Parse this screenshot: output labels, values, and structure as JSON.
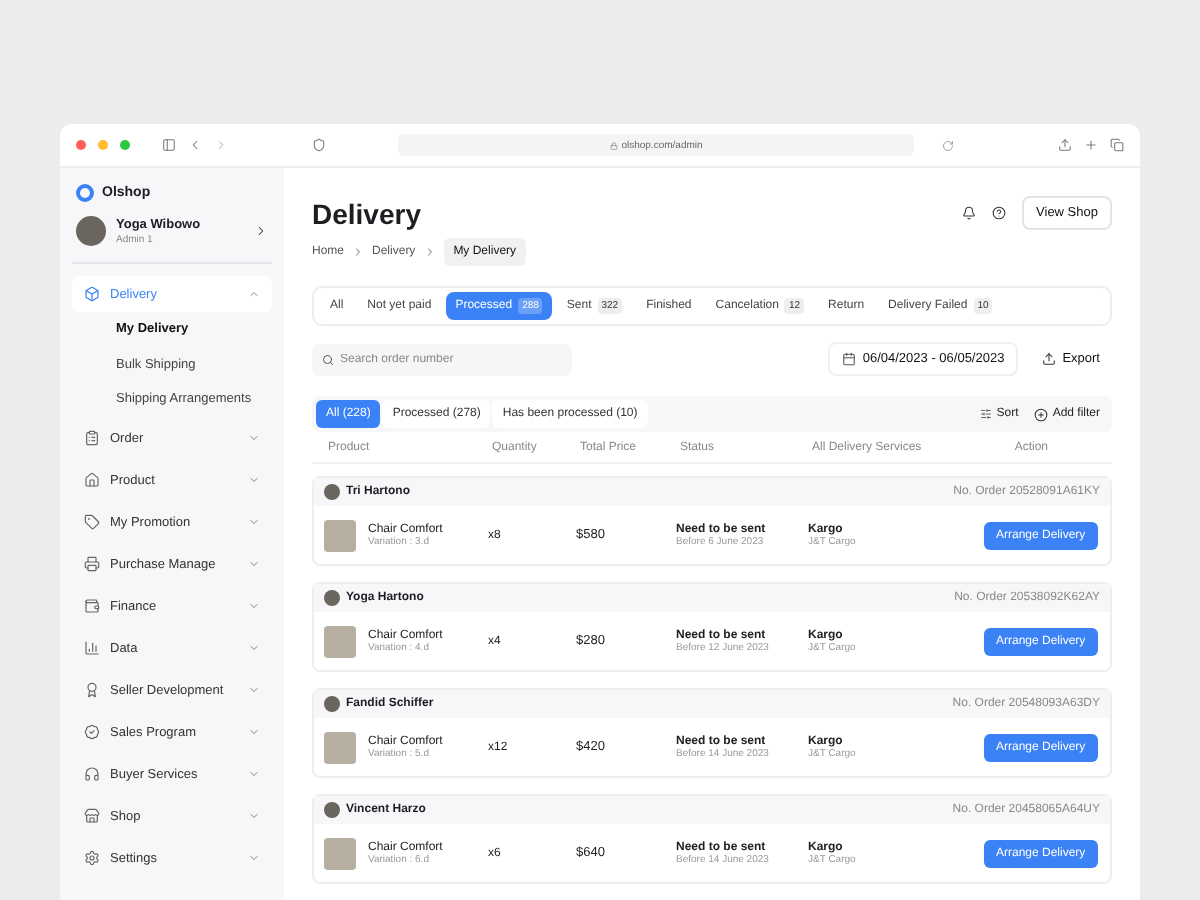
{
  "browser": {
    "url": "olshop.com/admin"
  },
  "sidebar": {
    "brand": "Olshop",
    "user": {
      "name": "Yoga Wibowo",
      "role": "Admin 1"
    },
    "items": [
      {
        "label": "Delivery",
        "expanded": true,
        "selected": true,
        "children": [
          {
            "label": "My Delivery",
            "selected": true
          },
          {
            "label": "Bulk Shipping",
            "selected": false
          },
          {
            "label": "Shipping Arrangements",
            "selected": false
          }
        ]
      },
      {
        "label": "Order",
        "expanded": false,
        "selected": false
      },
      {
        "label": "Product",
        "expanded": false,
        "selected": false
      },
      {
        "label": "My Promotion",
        "expanded": false,
        "selected": false
      },
      {
        "label": "Purchase Manage",
        "expanded": false,
        "selected": false
      },
      {
        "label": "Finance",
        "expanded": false,
        "selected": false
      },
      {
        "label": "Data",
        "expanded": false,
        "selected": false
      },
      {
        "label": "Seller Development",
        "expanded": false,
        "selected": false
      },
      {
        "label": "Sales Program",
        "expanded": false,
        "selected": false
      },
      {
        "label": "Buyer Services",
        "expanded": false,
        "selected": false
      },
      {
        "label": "Shop",
        "expanded": false,
        "selected": false
      },
      {
        "label": "Settings",
        "expanded": false,
        "selected": false
      }
    ]
  },
  "header": {
    "title": "Delivery",
    "view_shop": "View Shop"
  },
  "breadcrumb": [
    {
      "label": "Home",
      "selected": false
    },
    {
      "label": "Delivery",
      "selected": false
    },
    {
      "label": "My Delivery",
      "selected": true
    }
  ],
  "tabs": [
    {
      "label": "All",
      "selected": false
    },
    {
      "label": "Not yet paid",
      "selected": false
    },
    {
      "label": "Processed",
      "count": "288",
      "selected": true
    },
    {
      "label": "Sent",
      "count": "322",
      "selected": false
    },
    {
      "label": "Finished",
      "selected": false
    },
    {
      "label": "Cancelation",
      "count": "12",
      "selected": false
    },
    {
      "label": "Return",
      "selected": false
    },
    {
      "label": "Delivery Failed",
      "count": "10",
      "selected": false
    }
  ],
  "search": {
    "placeholder": "Search order number"
  },
  "date_range": "06/04/2023 - 06/05/2023",
  "export": "Export",
  "filters": [
    {
      "label": "All (228)",
      "selected": true
    },
    {
      "label": "Processed (278)",
      "selected": false
    },
    {
      "label": "Has been processed (10)",
      "selected": false
    }
  ],
  "sort": "Sort",
  "add_filter": "Add filter",
  "table": {
    "columns": [
      "Product",
      "Quantity",
      "Total Price",
      "Status",
      "All Delivery Services",
      "Action"
    ],
    "orders": [
      {
        "customer": "Tri Hartono",
        "order_no": "No. Order 20528091A61KY",
        "product": "Chair Comfort",
        "variation": "Variation : 3.d",
        "quantity": "x8",
        "price": "$580",
        "status": "Need to be sent",
        "deadline": "Before 6 June 2023",
        "service": "Kargo",
        "carrier": "J&T Cargo",
        "action": "Arrange Delivery"
      },
      {
        "customer": "Yoga Hartono",
        "order_no": "No. Order 20538092K62AY",
        "product": "Chair Comfort",
        "variation": "Variation : 4.d",
        "quantity": "x4",
        "price": "$280",
        "status": "Need to be sent",
        "deadline": "Before 12 June 2023",
        "service": "Kargo",
        "carrier": "J&T Cargo",
        "action": "Arrange Delivery"
      },
      {
        "customer": "Fandid Schiffer",
        "order_no": "No. Order 20548093A63DY",
        "product": "Chair Comfort",
        "variation": "Variation : 5.d",
        "quantity": "x12",
        "price": "$420",
        "status": "Need to be sent",
        "deadline": "Before 14 June 2023",
        "service": "Kargo",
        "carrier": "J&T Cargo",
        "action": "Arrange Delivery"
      },
      {
        "customer": "Vincent Harzo",
        "order_no": "No. Order 20458065A64UY",
        "product": "Chair Comfort",
        "variation": "Variation : 6.d",
        "quantity": "x6",
        "price": "$640",
        "status": "Need to be sent",
        "deadline": "Before 14 June 2023",
        "service": "Kargo",
        "carrier": "J&T Cargo",
        "action": "Arrange Delivery"
      }
    ]
  }
}
